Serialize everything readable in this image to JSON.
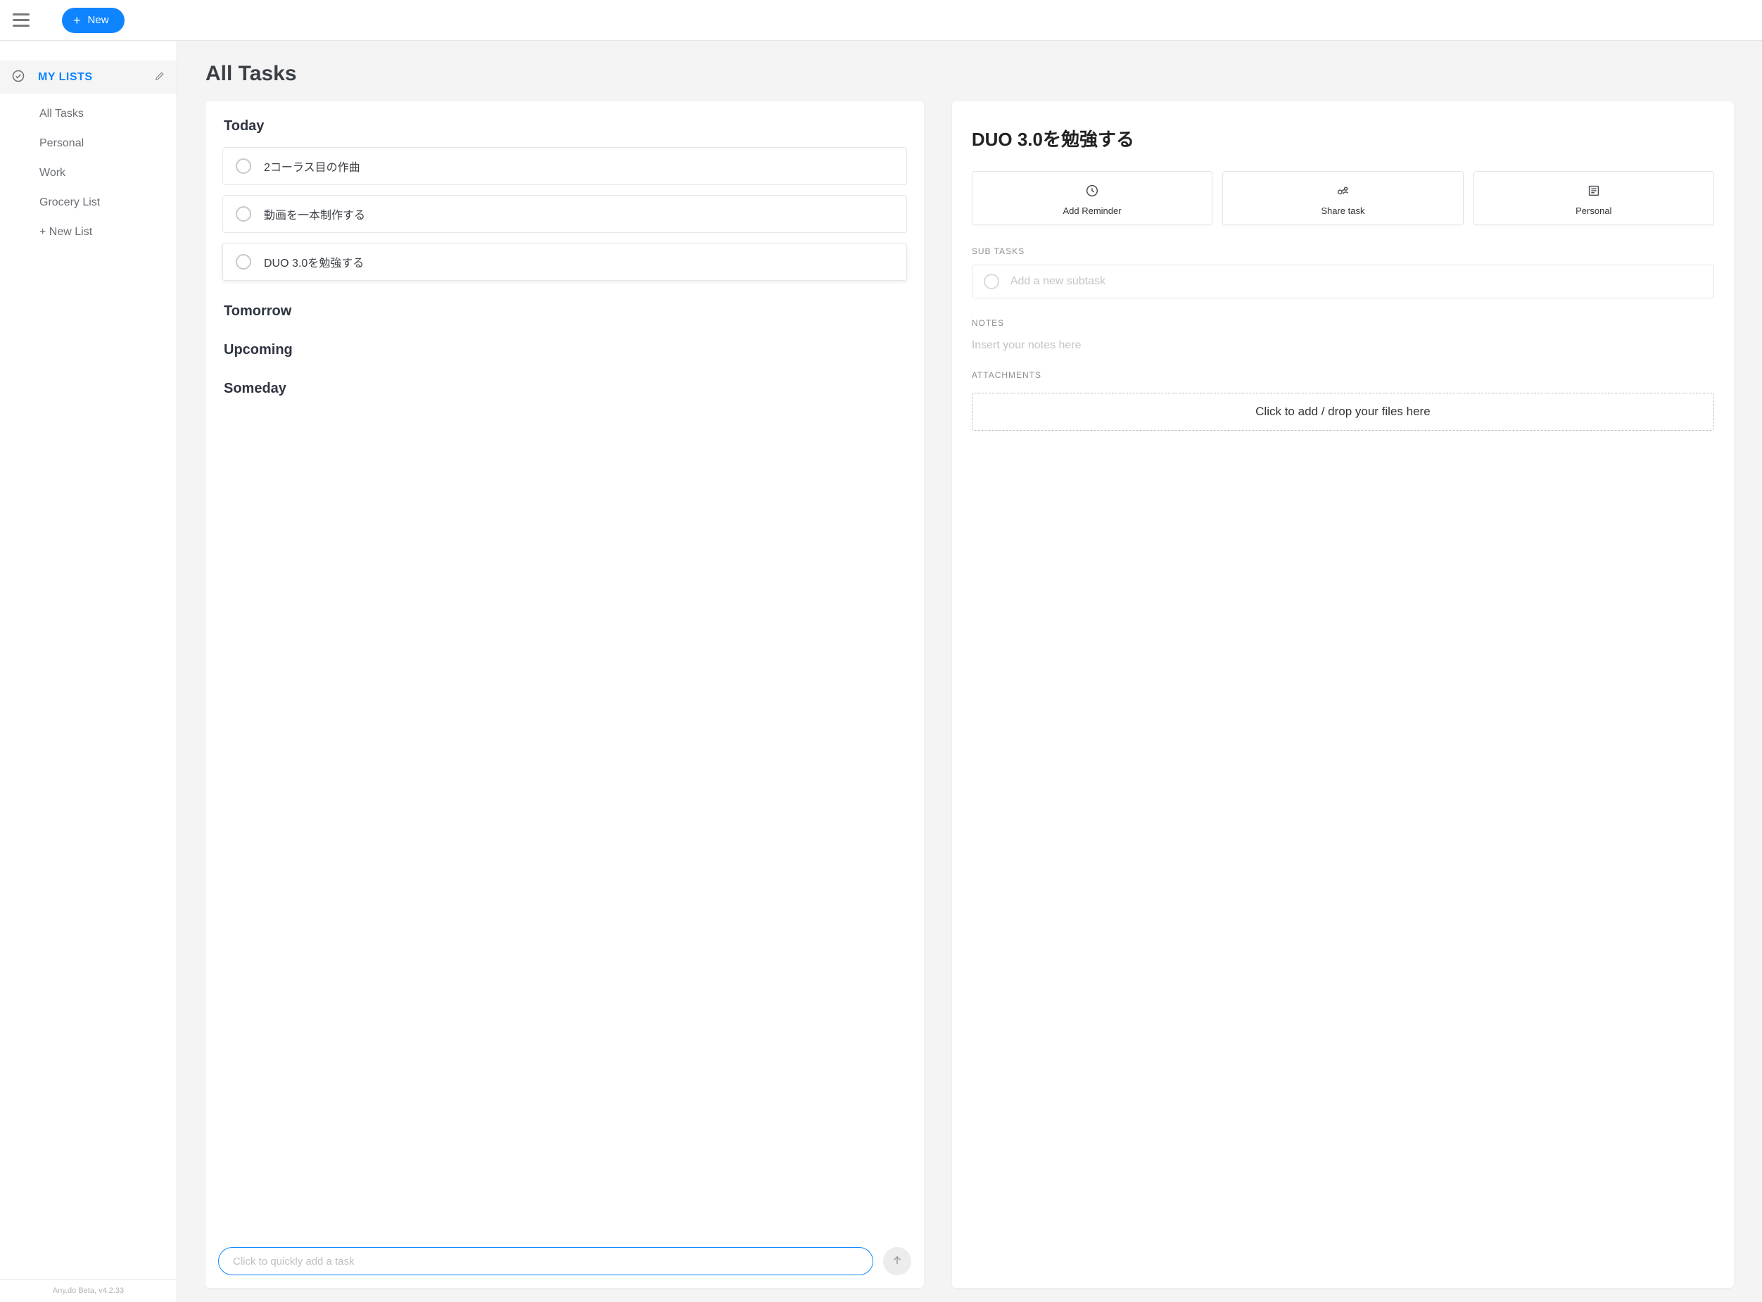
{
  "topbar": {
    "new_label": "New"
  },
  "sidebar": {
    "header_label": "MY LISTS",
    "items": [
      {
        "label": "All Tasks"
      },
      {
        "label": "Personal"
      },
      {
        "label": "Work"
      },
      {
        "label": "Grocery List"
      },
      {
        "label": "+ New List"
      }
    ],
    "footer": "Any.do Beta, v4.2.33"
  },
  "main": {
    "title": "All Tasks",
    "sections": {
      "today": "Today",
      "tomorrow": "Tomorrow",
      "upcoming": "Upcoming",
      "someday": "Someday"
    },
    "today_tasks": [
      {
        "label": "2コーラス目の作曲"
      },
      {
        "label": "動画を一本制作する"
      },
      {
        "label": "DUO 3.0を勉強する"
      }
    ],
    "quick_add_placeholder": "Click to quickly add a task"
  },
  "detail": {
    "title": "DUO 3.0を勉強する",
    "actions": [
      {
        "label": "Add Reminder"
      },
      {
        "label": "Share task"
      },
      {
        "label": "Personal"
      }
    ],
    "subtasks_heading": "SUB TASKS",
    "subtask_placeholder": "Add a new subtask",
    "notes_heading": "NOTES",
    "notes_placeholder": "Insert your notes here",
    "attachments_heading": "ATTACHMENTS",
    "dropzone_label": "Click to add / drop your files here"
  }
}
